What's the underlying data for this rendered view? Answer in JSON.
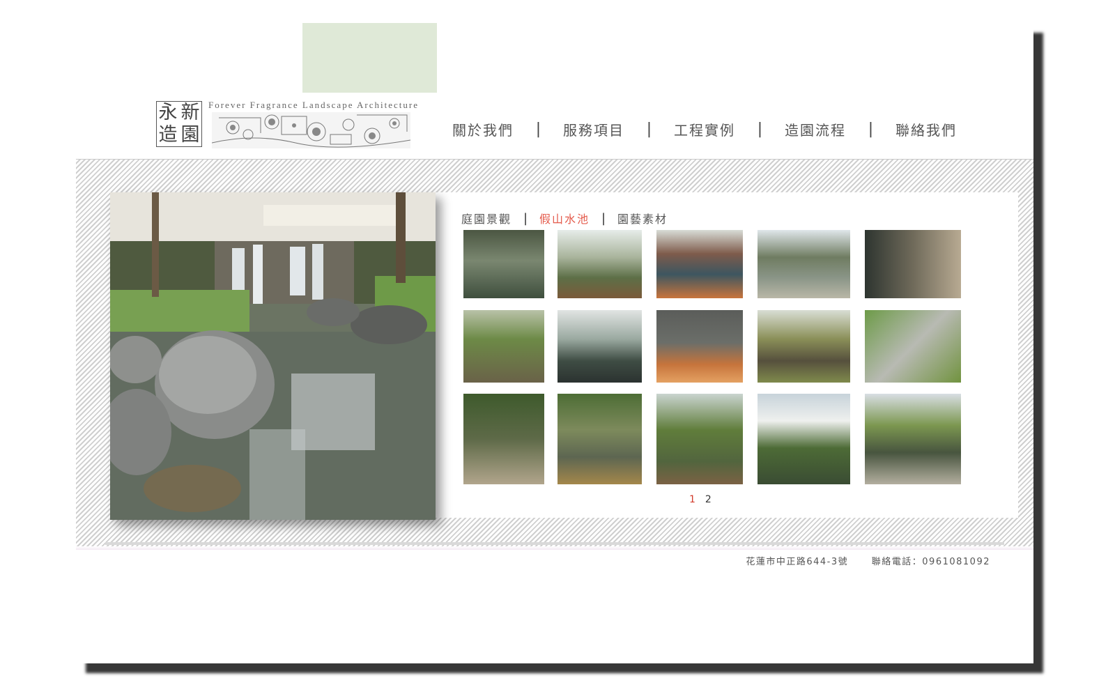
{
  "logo": {
    "chars": [
      "永",
      "新",
      "造",
      "園"
    ],
    "english": "Forever Fragrance Landscape Architecture"
  },
  "nav": {
    "items": [
      "關於我們",
      "服務項目",
      "工程實例",
      "造園流程",
      "聯絡我們"
    ],
    "separator": "|"
  },
  "gallery": {
    "tabs": [
      {
        "label": "庭園景觀",
        "active": false
      },
      {
        "label": "假山水池",
        "active": true
      },
      {
        "label": "園藝素材",
        "active": false
      }
    ],
    "separator": "|",
    "pages": [
      "1",
      "2"
    ],
    "current_page": "1",
    "thumbnail_count": 15
  },
  "footer": {
    "address": "花蓮市中正路644-3號",
    "phone": "聯絡電話：0961081092"
  },
  "colors": {
    "accent_red": "#e45a4b",
    "green_box": "#dfe9d7",
    "text": "#555555"
  }
}
